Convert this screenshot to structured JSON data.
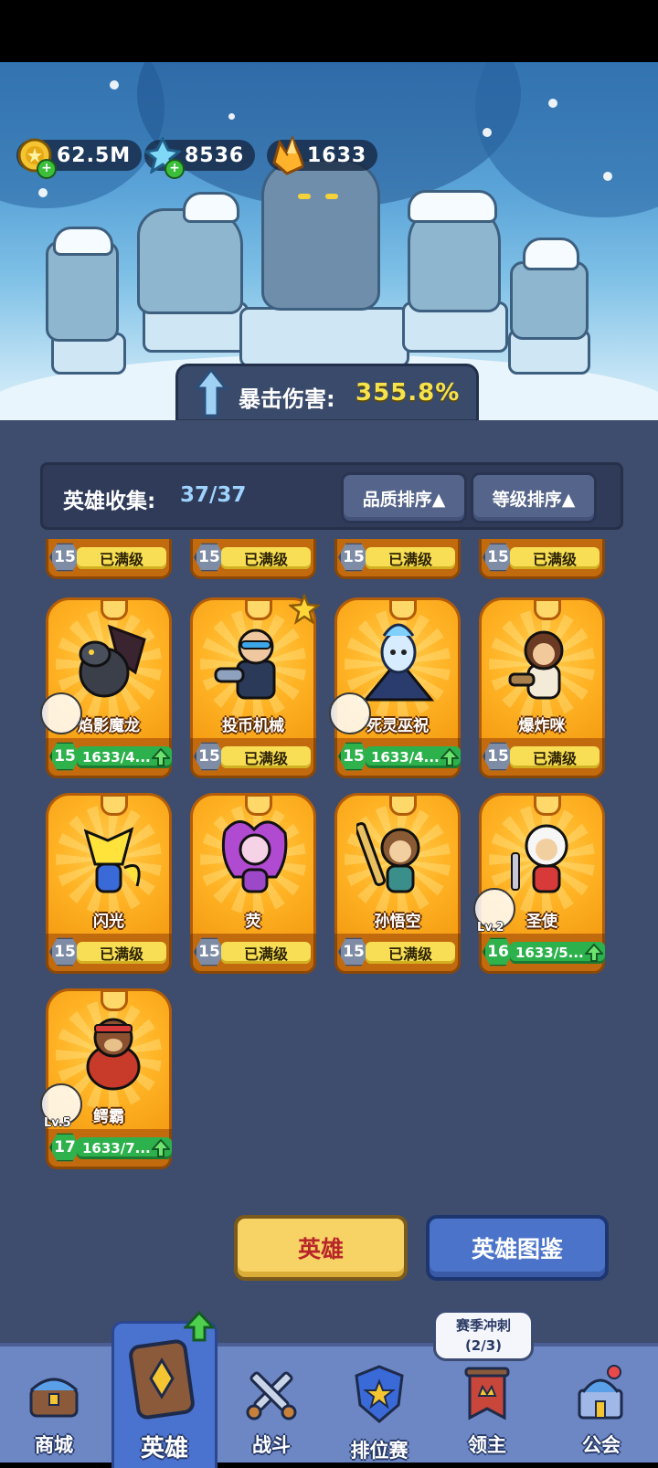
{
  "currencies": [
    {
      "icon": "gold-coin-icon",
      "value": "62.5M"
    },
    {
      "icon": "blue-crystal-icon",
      "value": "8536"
    },
    {
      "icon": "orange-crystal-icon",
      "value": "1633"
    }
  ],
  "crit": {
    "label": "暴击伤害:",
    "value": "355.8%"
  },
  "collection": {
    "label": "英雄收集:",
    "count": "37/37"
  },
  "sort": {
    "quality": "品质排序▲",
    "level": "等级排序▲"
  },
  "status_max": "已满级",
  "partial_row": [
    {
      "level": "15",
      "status": "已满级"
    },
    {
      "level": "15",
      "status": "已满级"
    },
    {
      "level": "15",
      "status": "已满级"
    },
    {
      "level": "15",
      "status": "已满级"
    }
  ],
  "heroes": [
    {
      "name": "焰影魔龙",
      "level": "15",
      "status": "1633/4...",
      "upgradable": true,
      "equip": "dark-armor-icon"
    },
    {
      "name": "投币机械",
      "level": "15",
      "status": "已满级",
      "upgradable": false,
      "star": true
    },
    {
      "name": "死灵巫祝",
      "level": "15",
      "status": "1633/4...",
      "upgradable": true,
      "equip": "gray-claw-icon"
    },
    {
      "name": "爆炸咪",
      "level": "15",
      "status": "已满级",
      "upgradable": false
    },
    {
      "name": "闪光",
      "level": "15",
      "status": "已满级",
      "upgradable": false
    },
    {
      "name": "荧",
      "level": "15",
      "status": "已满级",
      "upgradable": false
    },
    {
      "name": "孙悟空",
      "level": "15",
      "status": "已满级",
      "upgradable": false
    },
    {
      "name": "圣使",
      "level": "16",
      "status": "1633/5...",
      "upgradable": true,
      "equip": "gold-wings-icon",
      "equip_level": "Lv.2"
    },
    {
      "name": "鳄霸",
      "level": "17",
      "status": "1633/7...",
      "upgradable": true,
      "equip": "ice-shard-icon",
      "equip_level": "Lv.5"
    }
  ],
  "buttons": {
    "hero": "英雄",
    "guide": "英雄图鉴"
  },
  "tooltip": {
    "line1": "赛季冲刺",
    "line2": "(2/3)"
  },
  "nav": [
    {
      "label": "商城",
      "icon": "shop-chest-icon"
    },
    {
      "label": "英雄",
      "icon": "hero-card-icon",
      "active": true
    },
    {
      "label": "战斗",
      "icon": "crossed-swords-icon"
    },
    {
      "label": "排位赛",
      "icon": "rank-shield-icon"
    },
    {
      "label": "领主",
      "icon": "lord-banner-icon"
    },
    {
      "label": "公会",
      "icon": "guild-castle-icon"
    }
  ]
}
